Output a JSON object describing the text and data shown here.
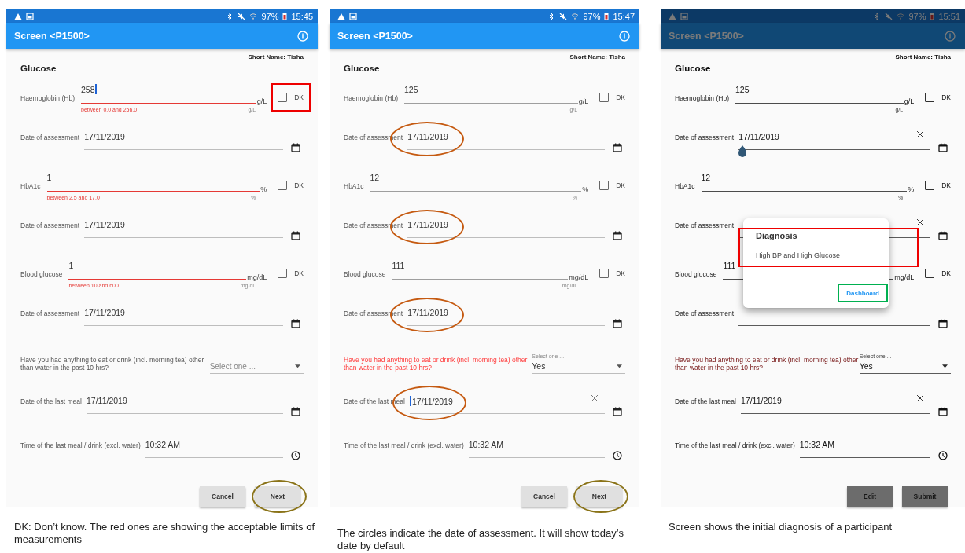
{
  "panels": [
    {
      "dimmed": false,
      "status_bar": {
        "battery": "97%",
        "time": "15:45"
      },
      "app_bar": {
        "title": "Screen <P1500>"
      },
      "short_name": "Short Name: Tisha",
      "section_title": "Glucose",
      "fields": [
        {
          "kind": "measure",
          "label": "Haemoglobin (Hb)",
          "value": "258",
          "focused": true,
          "unit": "g/L",
          "unit_hint": "g/L",
          "error": "between 0.0 and 256.0",
          "dk_label": "DK",
          "dk_checked": false,
          "dk_boxed": true
        },
        {
          "kind": "date",
          "label": "Date of assessment",
          "value": "17/11/2019",
          "circled": false,
          "clearable": false
        },
        {
          "kind": "measure",
          "label": "HbA1c",
          "value": "1",
          "focused": false,
          "unit": "%",
          "unit_hint": "%",
          "error": "between 2.5 and 17.0",
          "dk_label": "DK",
          "dk_checked": false,
          "dk_boxed": false
        },
        {
          "kind": "date",
          "label": "Date of assessment",
          "value": "17/11/2019",
          "circled": false,
          "clearable": false
        },
        {
          "kind": "measure",
          "label": "Blood glucose",
          "value": "1",
          "focused": false,
          "unit": "mg/dL",
          "unit_hint": "mg/dL",
          "error": "between 10 and 600",
          "dk_label": "DK",
          "dk_checked": false,
          "dk_boxed": false
        },
        {
          "kind": "date",
          "label": "Date of assessment",
          "value": "17/11/2019",
          "circled": false,
          "clearable": false
        },
        {
          "kind": "select",
          "label": "Have you had anything to eat or drink (incl. morning tea) other than water in the past 10 hrs?",
          "label_error": false,
          "placeholder": "Select one ..."
        },
        {
          "kind": "date",
          "label": "Date of the last meal",
          "value": "17/11/2019",
          "circled": false,
          "clearable": false
        },
        {
          "kind": "time",
          "label": "Time of the last meal / drink (excl. water)",
          "value": "10:32 AM"
        }
      ],
      "buttons": [
        {
          "label": "Cancel",
          "circled": false
        },
        {
          "label": "Next",
          "circled": true
        }
      ],
      "caption": "DK: Don’t know. The red ones are showing the acceptable limits of measurements"
    },
    {
      "dimmed": false,
      "status_bar": {
        "battery": "97%",
        "time": "15:47"
      },
      "app_bar": {
        "title": "Screen <P1500>"
      },
      "short_name": "Short Name: Tisha",
      "section_title": "Glucose",
      "fields": [
        {
          "kind": "measure",
          "label": "Haemoglobin (Hb)",
          "value": "125",
          "focused": false,
          "unit": "g/L",
          "unit_hint": "g/L",
          "dk_label": "DK",
          "dk_checked": false,
          "dk_boxed": false
        },
        {
          "kind": "date",
          "label": "Date of assessment",
          "value": "17/11/2019",
          "circled": true,
          "clearable": false
        },
        {
          "kind": "measure",
          "label": "HbA1c",
          "value": "12",
          "focused": false,
          "unit": "%",
          "unit_hint": "%",
          "dk_label": "DK",
          "dk_checked": false,
          "dk_boxed": false
        },
        {
          "kind": "date",
          "label": "Date of assessment",
          "value": "17/11/2019",
          "circled": true,
          "clearable": false
        },
        {
          "kind": "measure",
          "label": "Blood glucose",
          "value": "111",
          "focused": false,
          "unit": "mg/dL",
          "unit_hint": "mg/dL",
          "dk_label": "DK",
          "dk_checked": false,
          "dk_boxed": false
        },
        {
          "kind": "date",
          "label": "Date of assessment",
          "value": "17/11/2019",
          "circled": true,
          "clearable": false
        },
        {
          "kind": "select",
          "label": "Have you had anything to eat or drink (incl. morning tea) other than water in the past 10 hrs?",
          "label_error": true,
          "placeholder": "Select one ...",
          "value": "Yes"
        },
        {
          "kind": "date",
          "label": "Date of the last meal",
          "value": "17/11/2019",
          "focused": true,
          "circled": true,
          "clearable": true
        },
        {
          "kind": "time",
          "label": "Time of the last meal / drink (excl. water)",
          "value": "10:32 AM"
        }
      ],
      "buttons": [
        {
          "label": "Cancel",
          "circled": false
        },
        {
          "label": "Next",
          "circled": true
        }
      ],
      "caption": "The circles indicate the date of assessment. It will show today’s date by default"
    },
    {
      "dimmed": true,
      "status_bar": {
        "battery": "97%",
        "time": "15:51"
      },
      "app_bar": {
        "title": "Screen <P1500>"
      },
      "short_name": "Short Name: Tisha",
      "section_title": "Glucose",
      "fields": [
        {
          "kind": "measure",
          "label": "Haemoglobin (Hb)",
          "value": "125",
          "focused": false,
          "unit": "g/L",
          "unit_hint": "g/L",
          "dk_label": "DK",
          "dk_checked": false,
          "dk_boxed": false
        },
        {
          "kind": "date",
          "label": "Date of assessment",
          "value": "17/11/2019",
          "handle": true,
          "circled": false,
          "clearable": true
        },
        {
          "kind": "measure",
          "label": "HbA1c",
          "value": "12",
          "focused": false,
          "unit": "%",
          "unit_hint": "%",
          "dk_label": "DK",
          "dk_checked": false,
          "dk_boxed": false
        },
        {
          "kind": "date",
          "label": "Date of assessment",
          "circled": false,
          "clearable": true
        },
        {
          "kind": "measure",
          "label": "Blood glucose",
          "value": "111",
          "focused": false,
          "unit": "mg/dL",
          "dk_label": "DK",
          "dk_checked": false,
          "dk_boxed": false
        },
        {
          "kind": "date",
          "label": "Date of assessment",
          "circled": false,
          "clearable": false
        },
        {
          "kind": "select",
          "label": "Have you had anything to eat or drink (incl. morning tea) other than water in the past 10 hrs?",
          "label_error": true,
          "placeholder": "Select one ...",
          "value": "Yes"
        },
        {
          "kind": "date",
          "label": "Date of the last meal",
          "value": "17/11/2019",
          "circled": false,
          "clearable": true
        },
        {
          "kind": "time",
          "label": "Time of the last meal / drink (excl. water)",
          "value": "10:32 AM"
        }
      ],
      "buttons": [
        {
          "label": "Edit",
          "circled": false
        },
        {
          "label": "Submit",
          "circled": false
        }
      ],
      "dialog": {
        "title": "Diagnosis",
        "message": "High BP and High Glucose",
        "highlighted": true,
        "button": {
          "label": "Dashboard",
          "highlighted": true
        }
      },
      "caption": "Screen shows the initial diagnosis of a participant"
    }
  ]
}
